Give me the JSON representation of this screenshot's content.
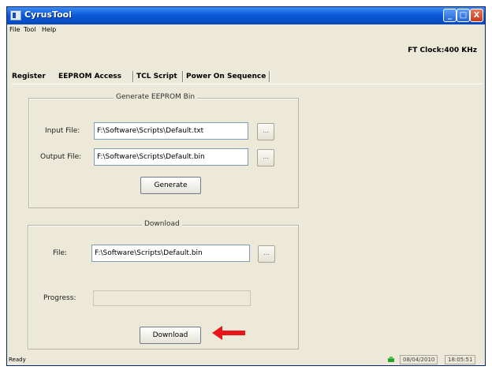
{
  "window": {
    "title": "CyrusTool"
  },
  "title_buttons": [
    "_",
    "□",
    "X"
  ],
  "menu": [
    "File",
    "Tool",
    "Help"
  ],
  "clock": "FT Clock:400 KHz",
  "tabs": [
    "Register",
    "EEPROM Access",
    "TCL Script",
    "Power On Sequence"
  ],
  "active_tab": "EEPROM Access",
  "generate_group": {
    "title": "Generate EEPROM Bin",
    "input_label": "Input File:",
    "input_value": "F:\\Software\\Scripts\\Default.txt",
    "output_label": "Output File:",
    "output_value": "F:\\Software\\Scripts\\Default.bin",
    "browse_label": "...",
    "generate_button": "Generate"
  },
  "download_group": {
    "title": "Download",
    "file_label": "File:",
    "file_value": "F:\\Software\\Scripts\\Default.bin",
    "browse_label": "...",
    "progress_label": "Progress:",
    "progress": 0,
    "download_button": "Download"
  },
  "status": {
    "text": "Ready",
    "date": "08/04/2010",
    "time": "18:05:51"
  },
  "colors": {
    "title_bar": "#0a5bd8",
    "window_bg": "#ece9d8",
    "arrow": "#e8151b"
  }
}
